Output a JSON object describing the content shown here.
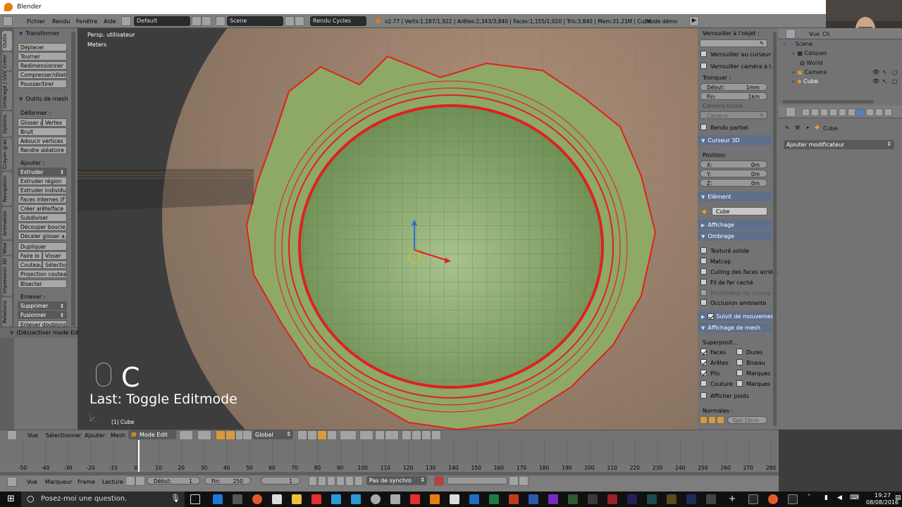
{
  "window": {
    "title": "Blender"
  },
  "menubar": {
    "menus": [
      "Fichier",
      "Rendu",
      "Fenêtre",
      "Aide"
    ],
    "screen_layout": "Default",
    "scene": "Scene",
    "engine": "Rendu Cycles",
    "stats": "v2.77 | Verts:1,187/1,922 | Arêtes:2,343/3,840 | Faces:1,155/1,920 | Tris:3,840 | Mem:31.21M | Cube",
    "mode_demo": "Mode démo"
  },
  "toolshelf": {
    "tabs": [
      "Outils",
      "Créer",
      "Ombrage / UVs",
      "Options",
      "Crayon gras",
      "Navigation",
      "Animation",
      "Mise",
      "Impression 3D",
      "Relations"
    ],
    "transformer": {
      "title": "Transformer",
      "buttons": [
        "Déplacer",
        "Tourner",
        "Redimensionner",
        "Compresser/dilater",
        "Pousser/tirer"
      ]
    },
    "outils_mesh": {
      "title": "Outils de mesh",
      "deformer_label": "Déformer :",
      "glisser": "Glisser a",
      "vertex": "Vertex",
      "buttons": [
        "Bruit",
        "Adoucir vertices",
        "Rendre aléatoire"
      ]
    },
    "ajouter": {
      "label": "Ajouter :",
      "extruder": "Extruder",
      "buttons": [
        "Extruder région",
        "Extruder individu...",
        "Faces internes (F)",
        "Créer arête/face",
        "Subdiviser",
        "Découper boucle...",
        "Décaler glisser a...",
        "Dupliquer"
      ],
      "faire_lo": "Faire lo",
      "visser": "Visser",
      "couteau": "Couteau",
      "selectio": "Sélectio",
      "projection": "Projection couteau",
      "bisecter": "Bisecter"
    },
    "enlever": {
      "label": "Enlever :",
      "supprimer": "Supprimer",
      "fusionner": "Fusionner",
      "enlever_doublons": "Enlever doublons"
    },
    "last_op": "(Dés)activer mode Edit"
  },
  "viewport": {
    "view_name": "Persp. utilisateur",
    "units": "Meters",
    "key_display": "C",
    "last_op": "Last: Toggle Editmode",
    "object_label": "(1) Cube"
  },
  "properties_panel": {
    "lock_label": "Verrouiller à l'objet :",
    "lock_cursor": "Verrouiller au curseur",
    "lock_camera": "Verrouiller caméra à l...",
    "clip_label": "Tronquer :",
    "clip_start_key": "Début:",
    "clip_start_val": "1mm",
    "clip_end_key": "Fin:",
    "clip_end_val": "1km",
    "local_camera_label": "Caméra locale :",
    "camera_value": "Camera",
    "render_border": "Rendu partiel",
    "cursor3d_title": "Curseur 3D",
    "position_label": "Position:",
    "x_key": "X:",
    "x_val": "0m",
    "y_key": "Y:",
    "y_val": "0m",
    "z_key": "Z:",
    "z_val": "0m",
    "item_title": "Elément",
    "item_name": "Cube",
    "display_title": "Affichage",
    "shading_title": "Ombrage",
    "textured_solid": "Texturé solide",
    "matcap": "Matcap",
    "backface": "Culling des faces arriè...",
    "hidden_wire": "Fil de fer caché",
    "dof": "Profondeur de champ",
    "ao": "Occlusion ambiante",
    "motion_tracking": "Suivit de mouvement (",
    "mesh_display_title": "Affichage de mesh",
    "overlays_label": "Superposit...",
    "faces": "Faces",
    "aretes": "Arêtes",
    "plis": "Plis",
    "couture": "Couture",
    "dures": "Dures",
    "biseau": "Biseau",
    "marques1": "Marques",
    "marques2": "Marques",
    "weights": "Afficher poids",
    "normals_label": "Normales :",
    "normal_size": "Taill:10cm"
  },
  "outliner": {
    "menu": [
      "Vue",
      "Ch"
    ],
    "items": [
      {
        "label": "Scene",
        "indent": 0
      },
      {
        "label": "Calques",
        "indent": 1
      },
      {
        "label": "World",
        "indent": 2
      },
      {
        "label": "Camera",
        "indent": 1
      },
      {
        "label": "Cube",
        "indent": 1
      }
    ]
  },
  "property_editor": {
    "breadcrumb": "Cube",
    "add_modifier": "Ajouter modificateur"
  },
  "viewport_header": {
    "menus": [
      "Vue",
      "Sélectionner",
      "Ajouter",
      "Mesh"
    ],
    "mode": "Mode Edit",
    "orientation": "Global"
  },
  "timeline": {
    "ticks": [
      -50,
      -40,
      -30,
      -20,
      -10,
      0,
      10,
      20,
      30,
      40,
      50,
      60,
      70,
      80,
      90,
      100,
      110,
      120,
      130,
      140,
      150,
      160,
      170,
      180,
      190,
      200,
      210,
      220,
      230,
      240,
      250,
      260,
      270,
      280
    ],
    "current_frame_value": 1,
    "menus": [
      "Vue",
      "Marqueur",
      "Frame",
      "Lecture"
    ],
    "start_key": "Début:",
    "start_val": "1",
    "end_key": "Fin:",
    "end_val": "250",
    "current": "1",
    "sync": "Pas de synchro"
  },
  "taskbar": {
    "search": "Posez-moi une question.",
    "time": "19:27",
    "date": "08/08/2016"
  }
}
